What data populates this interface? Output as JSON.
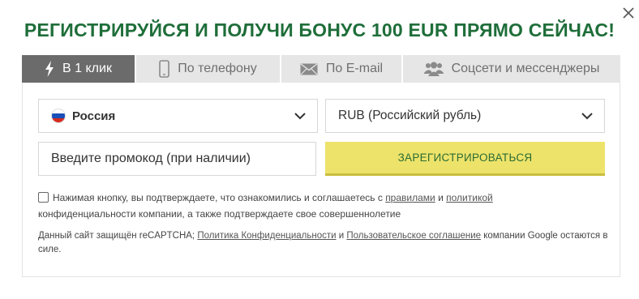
{
  "modal": {
    "headline": "РЕГИСТРИРУЙСЯ И ПОЛУЧИ БОНУС 100 EUR ПРЯМО СЕЙЧАС!",
    "close_icon": "close-icon"
  },
  "tabs": [
    {
      "label": "В 1 клик",
      "icon": "lightning-icon",
      "active": true
    },
    {
      "label": "По телефону",
      "icon": "phone-icon",
      "active": false
    },
    {
      "label": "По E-mail",
      "icon": "envelope-icon",
      "active": false
    },
    {
      "label": "Соцсети и мессенджеры",
      "icon": "users-icon",
      "active": false
    }
  ],
  "form": {
    "country": {
      "value": "Россия",
      "icon": "russia-flag-icon"
    },
    "currency": {
      "value": "RUB (Российский рубль)"
    },
    "promo": {
      "placeholder": "Введите промокод (при наличии)"
    },
    "register_label": "Зарегистрироваться"
  },
  "consent": {
    "text_before": "Нажимая кнопку, вы подтверждаете, что ознакомились и соглашаетесь с",
    "link_rules": "правилами",
    "and": "и",
    "link_policy": "политикой",
    "text_after": "конфиденциальности компании, а также подтверждаете свое совершеннолетие"
  },
  "recaptcha": {
    "text_before": "Данный сайт защищён reCAPTCHA;",
    "link_privacy": "Политика Конфиденциальности",
    "and": "и",
    "link_terms": "Пользовательское соглашение",
    "text_after": "компании Google остаются в силе."
  },
  "colors": {
    "headline": "#1f6e3a",
    "active_tab": "#6b6b6b",
    "register_button": "#ede36a",
    "register_text": "#2a6b33"
  }
}
